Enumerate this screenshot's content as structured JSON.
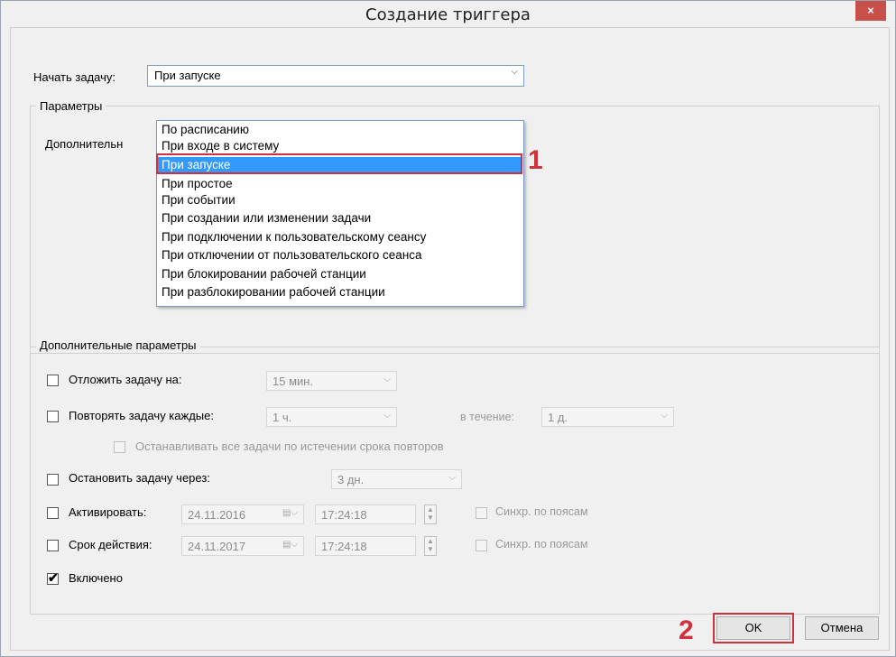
{
  "window": {
    "title": "Создание триггера",
    "close_icon": "close-icon",
    "close_glyph": "×"
  },
  "begin_task": {
    "label": "Начать задачу:",
    "selected": "При запуске",
    "options": [
      "По расписанию",
      "При входе в систему",
      "При запуске",
      "При простое",
      "При событии",
      "При создании или изменении задачи",
      "При подключении к пользовательскому сеансу",
      "При отключении от пользовательского сеанса",
      "При блокировании рабочей станции",
      "При разблокировании рабочей станции"
    ],
    "highlighted_index": 2
  },
  "params_group": {
    "legend": "Параметры",
    "partial_label": "Дополнительн"
  },
  "advanced": {
    "legend": "Дополнительные параметры",
    "delay": {
      "label": "Отложить задачу на:",
      "value": "15 мин."
    },
    "repeat": {
      "label": "Повторять задачу каждые:",
      "value": "1 ч.",
      "duration_label": "в течение:",
      "duration_value": "1 д."
    },
    "stop_all": {
      "label": "Останавливать все задачи по истечении срока повторов"
    },
    "stop_after": {
      "label": "Остановить задачу через:",
      "value": "3 дн."
    },
    "activate": {
      "label": "Активировать:",
      "date": "24.11.2016",
      "time": "17:24:18",
      "sync_label": "Синхр. по поясам"
    },
    "expire": {
      "label": "Срок действия:",
      "date": "24.11.2017",
      "time": "17:24:18",
      "sync_label": "Синхр. по поясам"
    },
    "enabled": {
      "label": "Включено",
      "checked": true
    }
  },
  "buttons": {
    "ok": "OK",
    "cancel": "Отмена"
  },
  "annotations": {
    "marker_1": "1",
    "marker_2": "2",
    "color": "#d0313d"
  },
  "colors": {
    "selection": "#3399ff",
    "close_button": "#c7504a"
  }
}
